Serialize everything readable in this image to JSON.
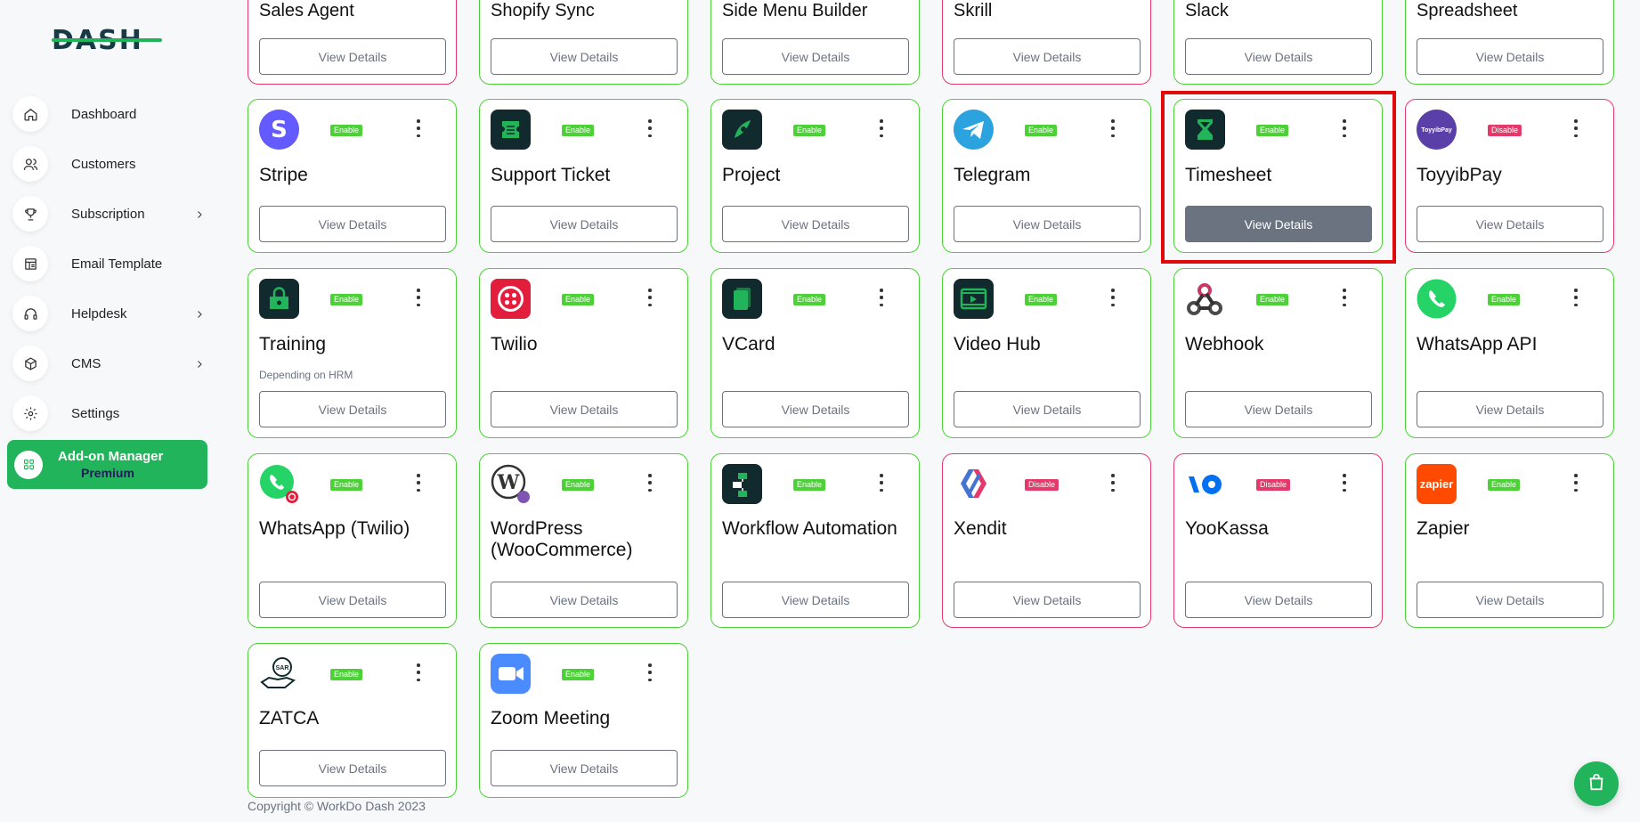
{
  "brand": {
    "logo_text": "DASH",
    "accent": "#22b45b",
    "enable_color": "#4cd137",
    "disable_color": "#e5396b",
    "highlight_color": "#e10a0a"
  },
  "sidebar": {
    "items": [
      {
        "label": "Dashboard",
        "icon": "home-icon",
        "has_submenu": false
      },
      {
        "label": "Customers",
        "icon": "users-icon",
        "has_submenu": false
      },
      {
        "label": "Subscription",
        "icon": "trophy-icon",
        "has_submenu": true
      },
      {
        "label": "Email Template",
        "icon": "template-icon",
        "has_submenu": false
      },
      {
        "label": "Helpdesk",
        "icon": "headphones-icon",
        "has_submenu": true
      },
      {
        "label": "CMS",
        "icon": "box-icon",
        "has_submenu": true
      },
      {
        "label": "Settings",
        "icon": "gear-icon",
        "has_submenu": false
      }
    ],
    "active": {
      "label": "Add-on Manager",
      "badge": "Premium",
      "icon": "apps-icon"
    }
  },
  "cards": [
    {
      "title": "Sales Agent",
      "status": "",
      "button": "View Details",
      "border": "disabled"
    },
    {
      "title": "Shopify Sync",
      "status": "",
      "button": "View Details",
      "border": "enabled"
    },
    {
      "title": "Side Menu Builder",
      "status": "",
      "button": "View Details",
      "border": "enabled"
    },
    {
      "title": "Skrill",
      "status": "",
      "button": "View Details",
      "border": "disabled"
    },
    {
      "title": "Slack",
      "status": "",
      "button": "View Details",
      "border": "enabled"
    },
    {
      "title": "Spreadsheet",
      "status": "",
      "button": "View Details",
      "border": "enabled"
    },
    {
      "title": "Stripe",
      "status": "Enable",
      "button": "View Details",
      "icon": "stripe-icon"
    },
    {
      "title": "Support Ticket",
      "status": "Enable",
      "button": "View Details",
      "icon": "ticket-icon"
    },
    {
      "title": "Project",
      "status": "Enable",
      "button": "View Details",
      "icon": "project-icon"
    },
    {
      "title": "Telegram",
      "status": "Enable",
      "button": "View Details",
      "icon": "telegram-icon"
    },
    {
      "title": "Timesheet",
      "status": "Enable",
      "button": "View Details",
      "icon": "hourglass-icon"
    },
    {
      "title": "ToyyibPay",
      "status": "Disable",
      "button": "View Details",
      "icon": "toyyibpay-icon",
      "logo_text": "ToyyibPay"
    },
    {
      "title": "Training",
      "status": "Enable",
      "button": "View Details",
      "subtitle": "Depending on HRM",
      "icon": "training-icon"
    },
    {
      "title": "Twilio",
      "status": "Enable",
      "button": "View Details",
      "icon": "twilio-icon"
    },
    {
      "title": "VCard",
      "status": "Enable",
      "button": "View Details",
      "icon": "vcard-icon"
    },
    {
      "title": "Video Hub",
      "status": "Enable",
      "button": "View Details",
      "icon": "video-icon"
    },
    {
      "title": "Webhook",
      "status": "Enable",
      "button": "View Details",
      "icon": "webhook-icon"
    },
    {
      "title": "WhatsApp API",
      "status": "Enable",
      "button": "View Details",
      "icon": "whatsapp-icon"
    },
    {
      "title": "WhatsApp (Twilio)",
      "status": "Enable",
      "button": "View Details",
      "icon": "whatsapp-twilio-icon"
    },
    {
      "title": "WordPress (WooCommerce)",
      "status": "Enable",
      "button": "View Details",
      "icon": "wordpress-icon",
      "logo_text": "W"
    },
    {
      "title": "Workflow Automation",
      "status": "Enable",
      "button": "View Details",
      "icon": "workflow-icon"
    },
    {
      "title": "Xendit",
      "status": "Disable",
      "button": "View Details",
      "icon": "xendit-icon"
    },
    {
      "title": "YooKassa",
      "status": "Disable",
      "button": "View Details",
      "icon": "yookassa-icon"
    },
    {
      "title": "Zapier",
      "status": "Enable",
      "button": "View Details",
      "icon": "zapier-icon",
      "logo_text": "zapier"
    },
    {
      "title": "ZATCA",
      "status": "Enable",
      "button": "View Details",
      "icon": "zatca-icon",
      "logo_text": "SAR"
    },
    {
      "title": "Zoom Meeting",
      "status": "Enable",
      "button": "View Details",
      "icon": "zoom-icon"
    }
  ],
  "footer": {
    "copyright": "Copyright © WorkDo Dash 2023"
  },
  "cart": {
    "icon": "shopping-bag-icon"
  }
}
